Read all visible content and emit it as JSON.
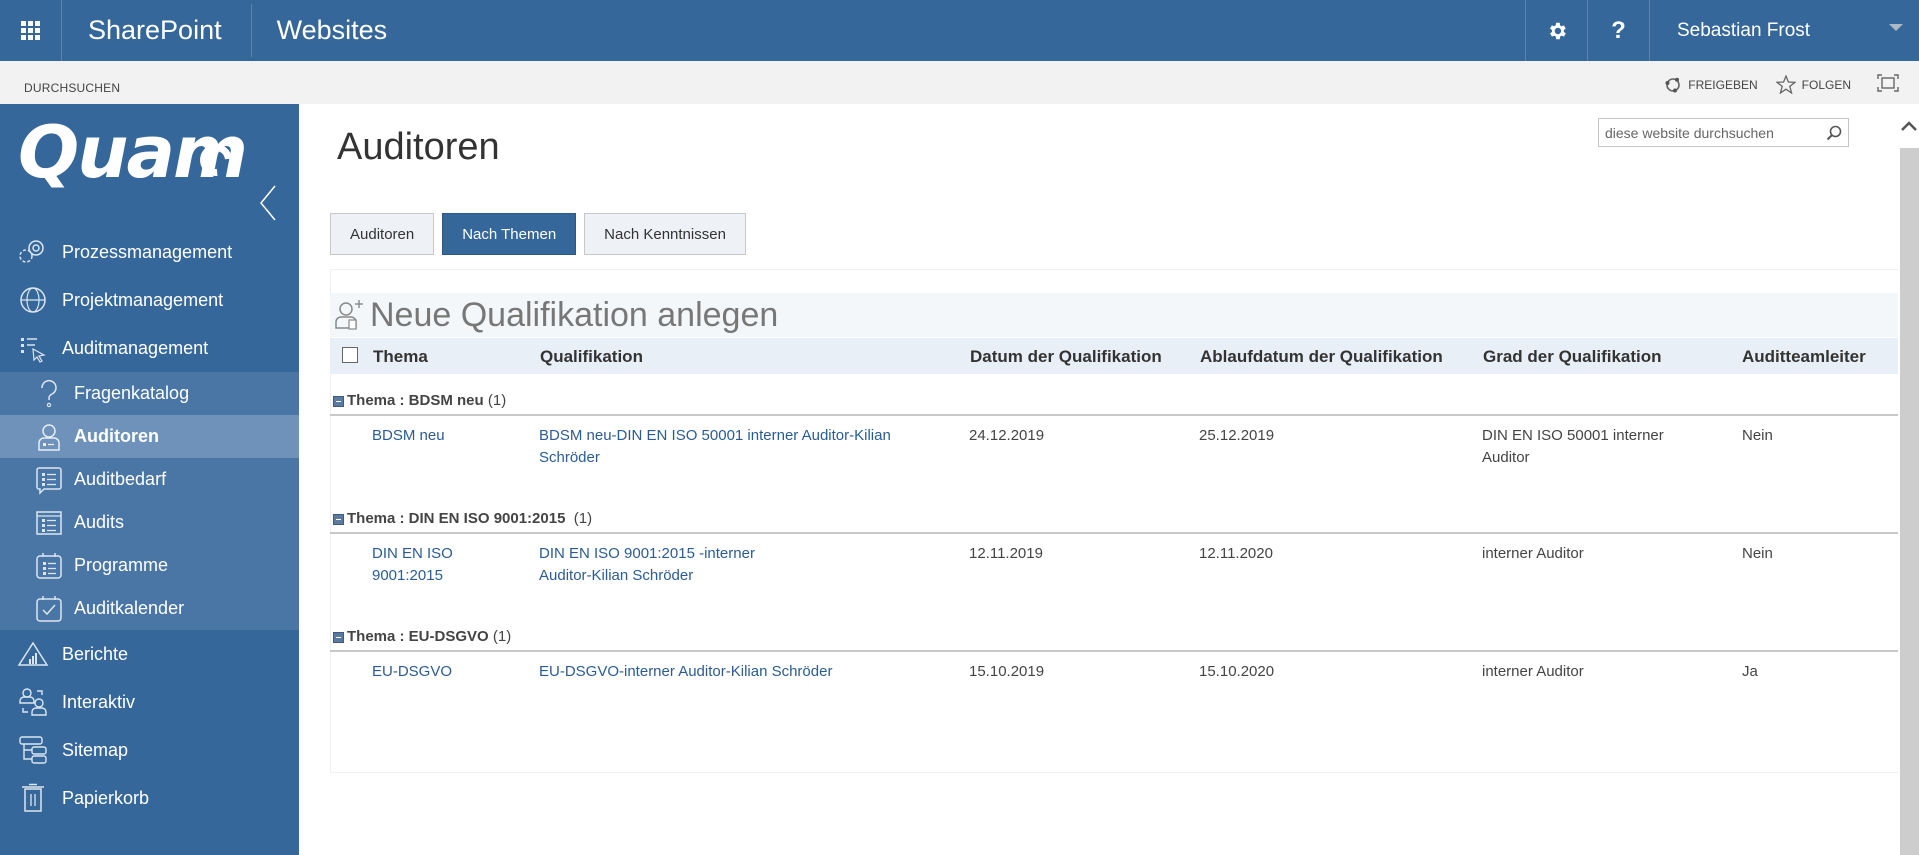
{
  "suitebar": {
    "brand": "SharePoint",
    "site_title": "Websites",
    "settings_icon": "gear-icon",
    "help_label": "?",
    "user_name": "Sebastian Frost"
  },
  "ribbon": {
    "browse_tab": "DURCHSUCHEN",
    "share_label": "FREIGEBEN",
    "follow_label": "FOLGEN"
  },
  "leftnav": {
    "logo_text": "Quam",
    "items": [
      {
        "label": "Prozessmanagement",
        "icon": "gears-icon"
      },
      {
        "label": "Projektmanagement",
        "icon": "globe-icon"
      },
      {
        "label": "Auditmanagement",
        "icon": "list-cursor-icon"
      }
    ],
    "sub_items": [
      {
        "label": "Fragenkatalog",
        "icon": "question-icon"
      },
      {
        "label": "Auditoren",
        "icon": "person-badge-icon",
        "active": true
      },
      {
        "label": "Auditbedarf",
        "icon": "list-speech-icon"
      },
      {
        "label": "Audits",
        "icon": "list-window-icon"
      },
      {
        "label": "Programme",
        "icon": "calendar-list-icon"
      },
      {
        "label": "Auditkalender",
        "icon": "calendar-check-icon"
      }
    ],
    "bottom_items": [
      {
        "label": "Berichte",
        "icon": "chart-triangle-icon"
      },
      {
        "label": "Interaktiv",
        "icon": "people-exchange-icon"
      },
      {
        "label": "Sitemap",
        "icon": "sitemap-icon"
      },
      {
        "label": "Papierkorb",
        "icon": "trash-icon"
      }
    ]
  },
  "main": {
    "page_title": "Auditoren",
    "search_placeholder": "diese website durchsuchen",
    "tabs": [
      {
        "label": "Auditoren",
        "active": false
      },
      {
        "label": "Nach Themen",
        "active": true
      },
      {
        "label": "Nach Kenntnissen",
        "active": false
      }
    ],
    "new_item_label": "Neue Qualifikation anlegen",
    "columns": [
      "Thema",
      "Qualifikation",
      "Datum der Qualifikation",
      "Ablaufdatum der Qualifikation",
      "Grad der Qualifikation",
      "Auditteamleiter"
    ],
    "groups": [
      {
        "label": "Thema : BDSM neu",
        "count": "(1)",
        "rows": [
          {
            "thema": "BDSM neu",
            "qualifikation": "BDSM neu-DIN EN ISO 50001 interner Auditor-Kilian Schröder",
            "datum": "24.12.2019",
            "ablaufdatum": "25.12.2019",
            "grad": "DIN EN ISO 50001 interner Auditor",
            "teamleiter": "Nein"
          }
        ]
      },
      {
        "label": "Thema : DIN EN ISO 9001:2015 ",
        "count": "(1)",
        "rows": [
          {
            "thema": "DIN EN ISO 9001:2015",
            "qualifikation": "DIN EN ISO 9001:2015 -interner Auditor-Kilian Schröder",
            "datum": "12.11.2019",
            "ablaufdatum": "12.11.2020",
            "grad": "interner Auditor",
            "teamleiter": "Nein"
          }
        ]
      },
      {
        "label": "Thema : EU-DSGVO",
        "count": "(1)",
        "rows": [
          {
            "thema": "EU-DSGVO",
            "qualifikation": "EU-DSGVO-interner Auditor-Kilian Schröder",
            "datum": "15.10.2019",
            "ablaufdatum": "15.10.2020",
            "grad": "interner Auditor",
            "teamleiter": "Ja"
          }
        ]
      }
    ]
  },
  "colors": {
    "brand_blue": "#36679a",
    "subnav_blue": "#4a76a6",
    "active_item": "#6e92ba",
    "link": "#2a5c93"
  }
}
